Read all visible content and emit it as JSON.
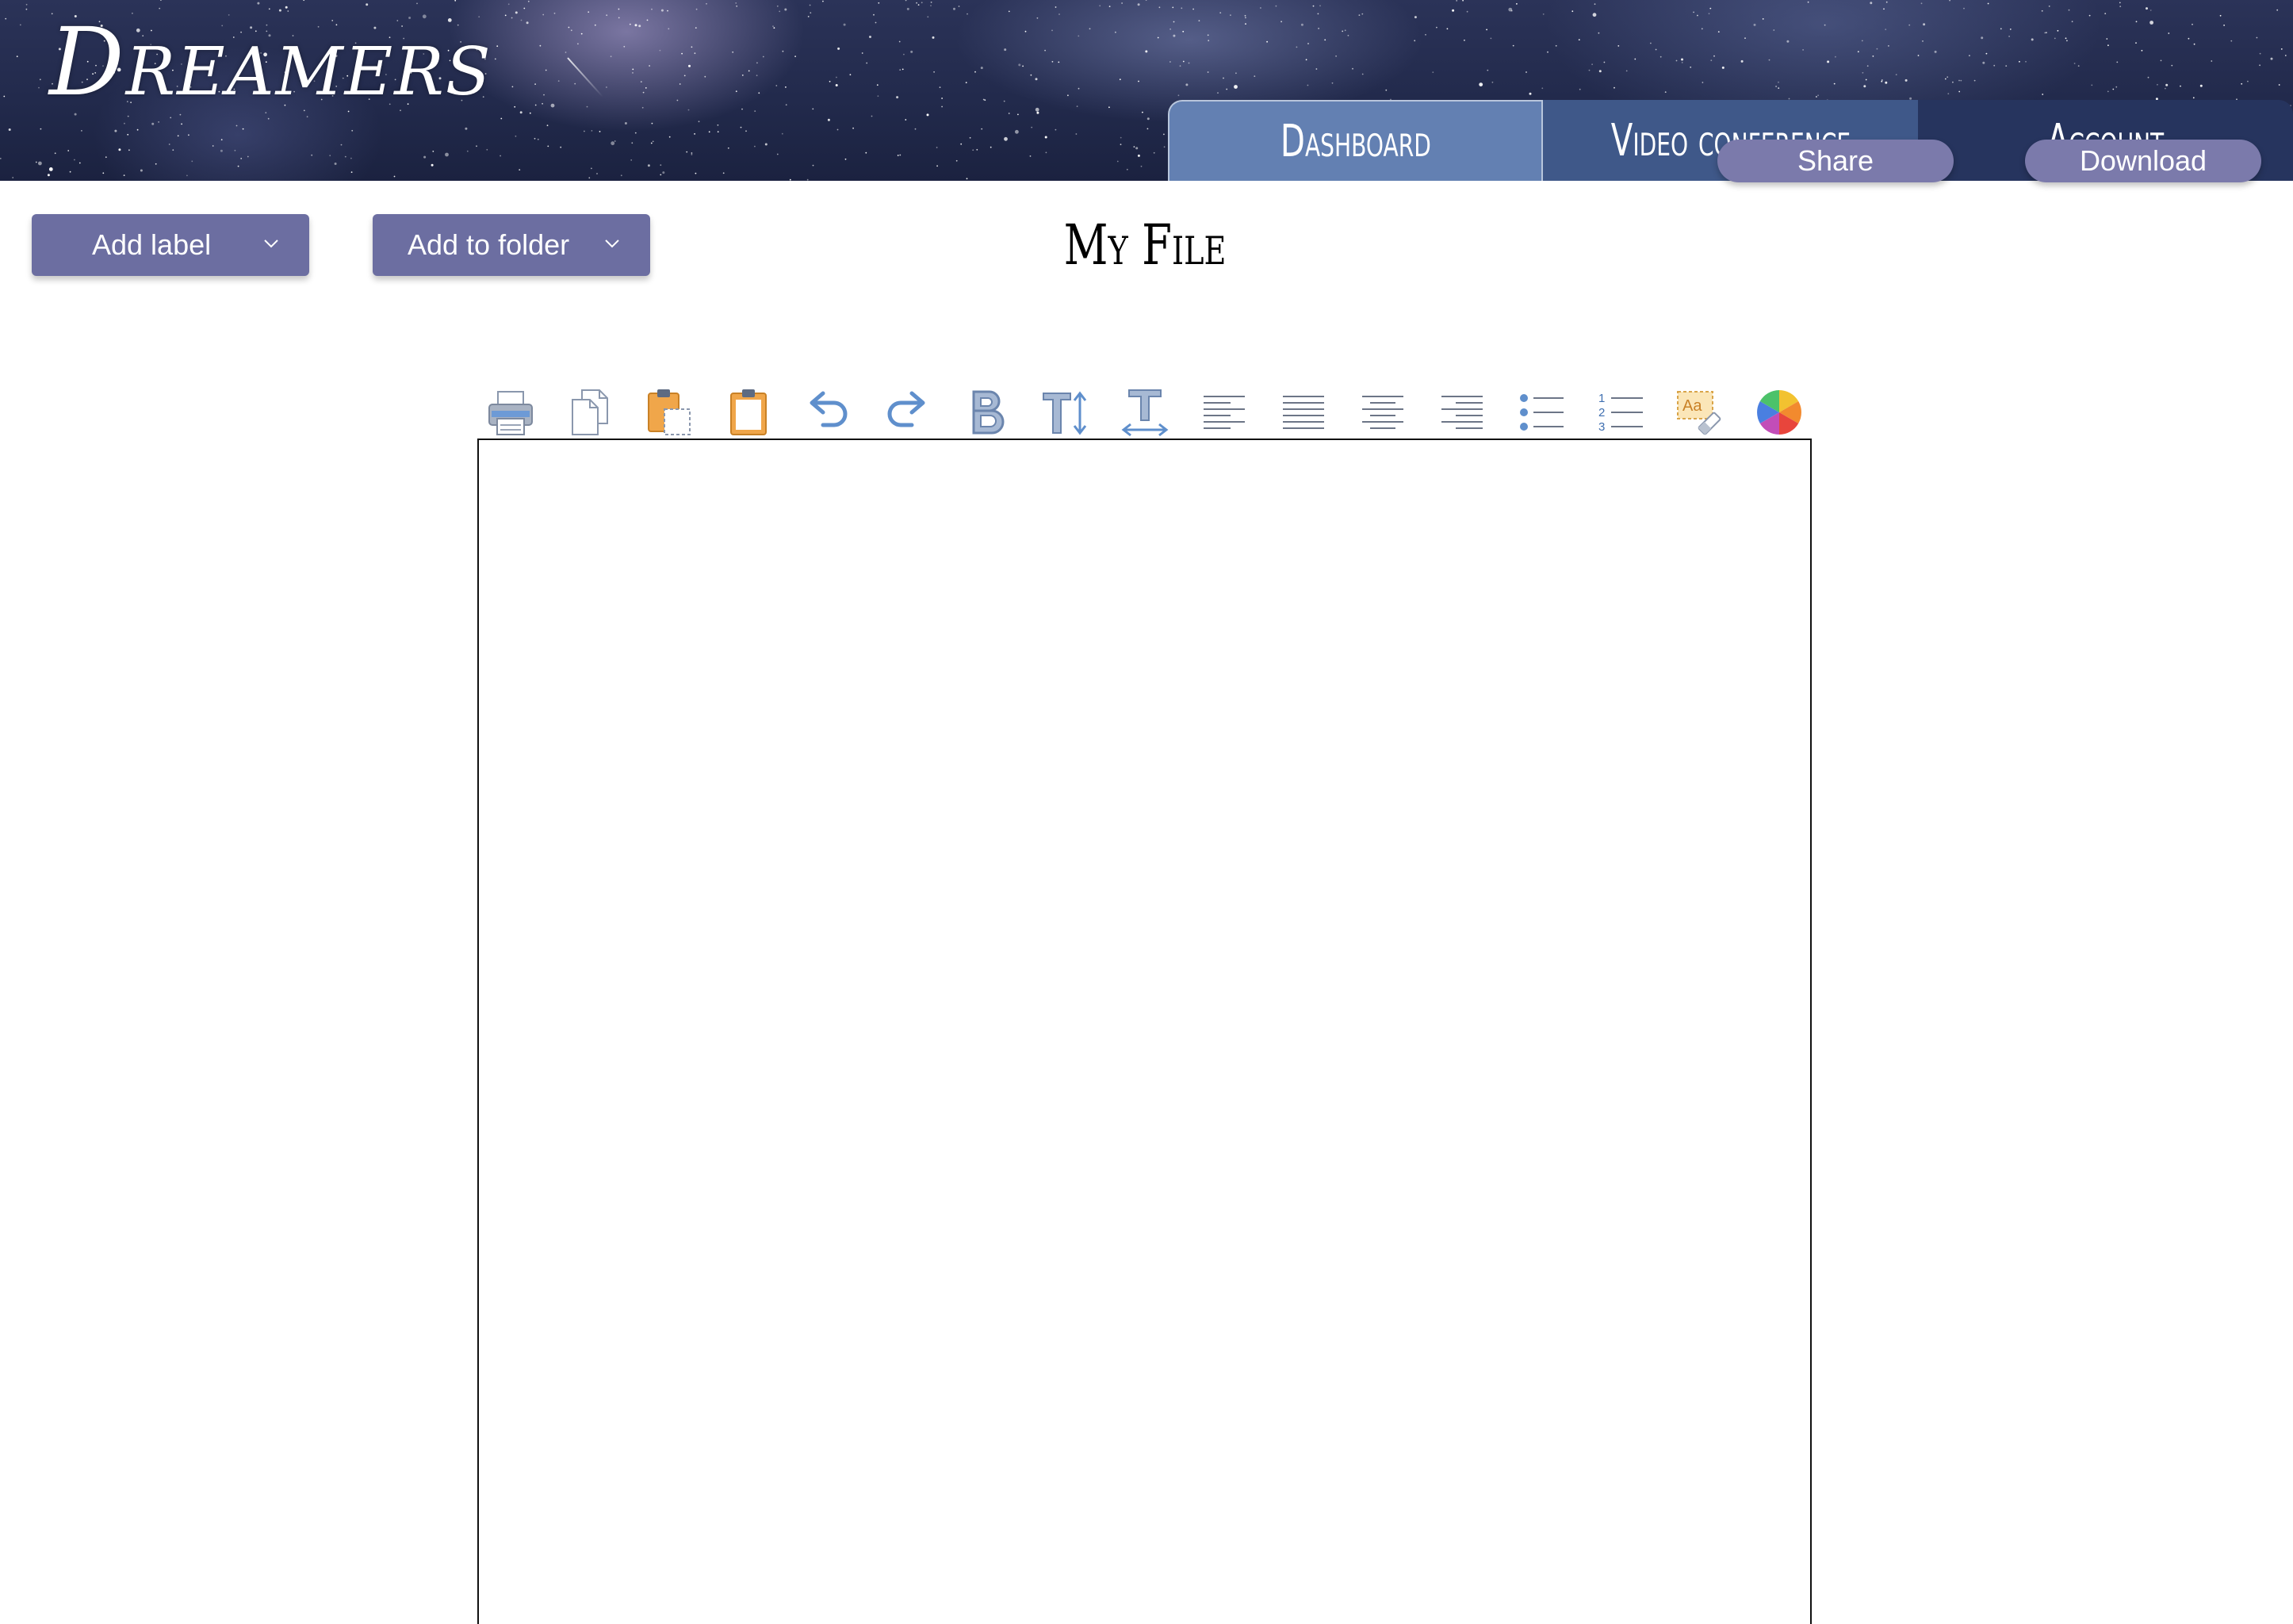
{
  "app": {
    "logo_text": "Dreamers"
  },
  "nav": {
    "tabs": [
      {
        "label": "Dashboard",
        "active": true
      },
      {
        "label": "Video conference",
        "active": false
      },
      {
        "label": "Account",
        "active": false
      }
    ]
  },
  "header_actions": {
    "share_label": "Share",
    "download_label": "Download"
  },
  "actions": {
    "add_label": "Add label",
    "add_to_folder": "Add to folder"
  },
  "document": {
    "title": "My File",
    "content": ""
  },
  "toolbar": {
    "tools": [
      "print-icon",
      "copy-icon",
      "paste-special-icon",
      "paste-icon",
      "undo-icon",
      "redo-icon",
      "bold-icon",
      "font-size-icon",
      "text-width-icon",
      "align-left-icon",
      "justify-icon",
      "align-center-icon",
      "align-right-icon",
      "bullet-list-icon",
      "numbered-list-icon",
      "clear-formatting-icon",
      "color-picker-icon"
    ],
    "numbered_list_digits": [
      "1",
      "2",
      "3"
    ],
    "clear_formatting_glyph": "Aa"
  },
  "colors": {
    "button": "#6c6ea1",
    "pill": "#7b7aab",
    "tab_active": "#6380b2",
    "tab_mid": "#3f5889",
    "tab_dark": "#26345e",
    "icon_blue": "#5f8fcc",
    "icon_orange": "#f0a64a"
  }
}
